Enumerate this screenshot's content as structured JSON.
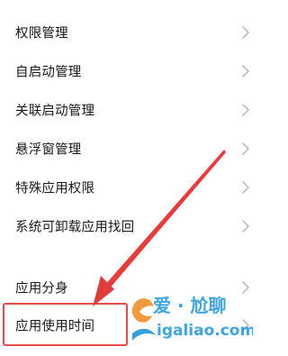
{
  "settings_list": {
    "items": [
      {
        "label": "权限管理"
      },
      {
        "label": "自启动管理"
      },
      {
        "label": "关联启动管理"
      },
      {
        "label": "悬浮窗管理"
      },
      {
        "label": "特殊应用权限"
      },
      {
        "label": "系统可卸载应用找回"
      },
      {
        "label": "应用分身"
      },
      {
        "label": "应用使用时间"
      }
    ],
    "chevron_icon": "chevron-right-icon",
    "highlighted_item": "应用使用时间"
  },
  "annotation": {
    "highlight_color": "#e84a4a",
    "arrow_color": "#e23b3b"
  },
  "watermark": {
    "brand_text": "爱 · 尬聊",
    "url_text": "igaliao.com",
    "color": "#0f8fd6"
  }
}
